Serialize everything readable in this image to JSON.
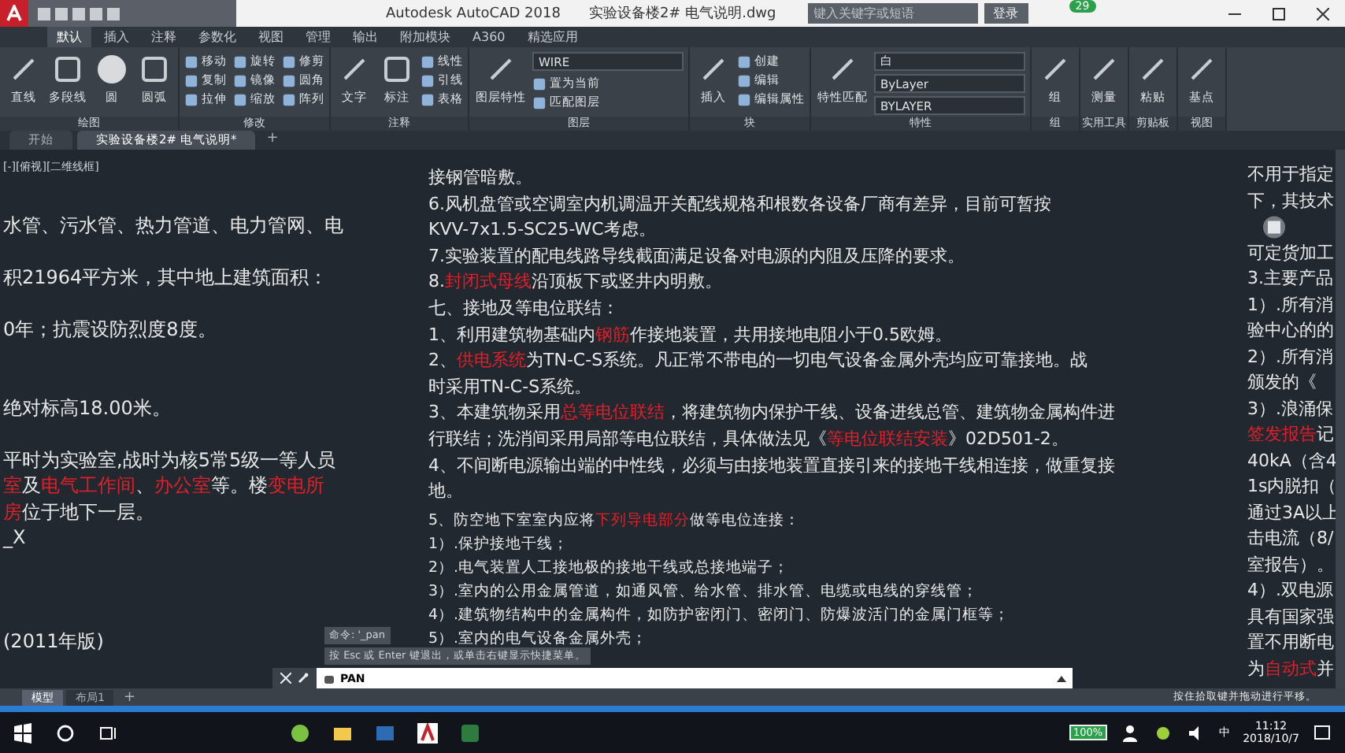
{
  "title_bar": {
    "app": "Autodesk AutoCAD 2018",
    "file": "实验设备楼2# 电气说明.dwg",
    "search": {
      "placeholder": "键入关键字或短语"
    },
    "login": "登录",
    "badge": "29"
  },
  "ribbon_tabs": [
    {
      "label": "默认",
      "selected": true
    },
    {
      "label": "插入",
      "selected": false
    },
    {
      "label": "注释",
      "selected": false
    },
    {
      "label": "参数化",
      "selected": false
    },
    {
      "label": "视图",
      "selected": false
    },
    {
      "label": "管理",
      "selected": false
    },
    {
      "label": "输出",
      "selected": false
    },
    {
      "label": "附加模块",
      "selected": false
    },
    {
      "label": "A360",
      "selected": false
    },
    {
      "label": "精选应用",
      "selected": false
    }
  ],
  "ribbon_panels": [
    {
      "title": "绘图",
      "tools": [
        {
          "kind": "large",
          "label": "直线"
        },
        {
          "kind": "large",
          "label": "多段线"
        },
        {
          "kind": "large",
          "label": "圆"
        },
        {
          "kind": "large",
          "label": "圆弧"
        }
      ]
    },
    {
      "title": "修改",
      "tools": [
        {
          "kind": "small",
          "label": "移动"
        },
        {
          "kind": "small",
          "label": "复制"
        },
        {
          "kind": "small",
          "label": "拉伸"
        },
        {
          "kind": "small",
          "label": "旋转"
        },
        {
          "kind": "small",
          "label": "镜像"
        },
        {
          "kind": "small",
          "label": "缩放"
        },
        {
          "kind": "small",
          "label": "修剪"
        },
        {
          "kind": "small",
          "label": "圆角"
        },
        {
          "kind": "small",
          "label": "阵列"
        }
      ]
    },
    {
      "title": "注释",
      "tools": [
        {
          "kind": "large",
          "label": "文字"
        },
        {
          "kind": "large",
          "label": "标注"
        },
        {
          "kind": "small",
          "label": "线性"
        },
        {
          "kind": "small",
          "label": "引线"
        },
        {
          "kind": "small",
          "label": "表格"
        }
      ]
    },
    {
      "title": "图层",
      "tools": [
        {
          "kind": "large",
          "label": "图层特性"
        },
        {
          "kind": "dropdown",
          "label": "WIRE"
        },
        {
          "kind": "small",
          "label": "置为当前"
        },
        {
          "kind": "small",
          "label": "匹配图层"
        }
      ]
    },
    {
      "title": "块",
      "tools": [
        {
          "kind": "large",
          "label": "插入"
        },
        {
          "kind": "small",
          "label": "创建"
        },
        {
          "kind": "small",
          "label": "编辑"
        },
        {
          "kind": "small",
          "label": "编辑属性"
        }
      ]
    },
    {
      "title": "特性",
      "tools": [
        {
          "kind": "large",
          "label": "特性匹配"
        },
        {
          "kind": "dropdown",
          "label": "白"
        },
        {
          "kind": "dropdown",
          "label": "ByLayer"
        },
        {
          "kind": "dropdown",
          "label": "BYLAYER"
        }
      ]
    },
    {
      "title": "组",
      "tools": [
        {
          "kind": "large",
          "label": "组"
        }
      ]
    },
    {
      "title": "实用工具",
      "tools": [
        {
          "kind": "large",
          "label": "测量"
        }
      ]
    },
    {
      "title": "剪贴板",
      "tools": [
        {
          "kind": "large",
          "label": "粘贴"
        }
      ]
    },
    {
      "title": "视图",
      "tools": [
        {
          "kind": "large",
          "label": "基点"
        }
      ]
    }
  ],
  "file_tabs": [
    {
      "label": "开始",
      "selected": false
    },
    {
      "label": "实验设备楼2# 电气说明*",
      "selected": true
    }
  ],
  "new_tab_button": "+",
  "viewport_label": "[-][俯视][二维线框]",
  "left_column": [
    {
      "kind": "text",
      "segments": [
        {
          "text": "水管、污水管、热力管道、电力管网、电",
          "highlight": false
        }
      ]
    },
    {
      "kind": "blank"
    },
    {
      "kind": "text",
      "segments": [
        {
          "text": "积21964平方米，其中地上建筑面积：",
          "highlight": false
        }
      ]
    },
    {
      "kind": "blank"
    },
    {
      "kind": "text",
      "segments": [
        {
          "text": "0年；抗震设防烈度8度。",
          "highlight": false
        }
      ]
    },
    {
      "kind": "blank"
    },
    {
      "kind": "blank"
    },
    {
      "kind": "text",
      "segments": [
        {
          "text": "绝对标高18.00米。",
          "highlight": false
        }
      ]
    },
    {
      "kind": "blank"
    },
    {
      "kind": "text",
      "segments": [
        {
          "text": "平时为实验室,战时为核5常5级一等人员",
          "highlight": false
        }
      ]
    },
    {
      "kind": "text",
      "segments": [
        {
          "text": "室",
          "highlight": true
        },
        {
          "text": "及",
          "highlight": false
        },
        {
          "text": "电气工作间",
          "highlight": true
        },
        {
          "text": "、",
          "highlight": false
        },
        {
          "text": "办公室",
          "highlight": true
        },
        {
          "text": "等。楼",
          "highlight": false
        },
        {
          "text": "变电所",
          "highlight": true
        }
      ]
    },
    {
      "kind": "text",
      "segments": [
        {
          "text": "房",
          "highlight": true
        },
        {
          "text": "位于地下一层。",
          "highlight": false
        }
      ]
    },
    {
      "kind": "text",
      "segments": [
        {
          "text": "_X",
          "highlight": false
        }
      ]
    },
    {
      "kind": "blank"
    },
    {
      "kind": "blank"
    },
    {
      "kind": "blank"
    },
    {
      "kind": "text",
      "segments": [
        {
          "text": "(2011年版)",
          "highlight": false
        }
      ]
    }
  ],
  "middle_column": {
    "lines": [
      [
        {
          "text": "接钢管暗敷。",
          "highlight": false
        }
      ],
      [
        {
          "text": "6.风机盘管或空调室内机调温开关配线规格和根数各设备厂商有差异，目前可暂按",
          "highlight": false
        }
      ],
      [
        {
          "text": "KVV-7x1.5-SC25-WC考虑。",
          "highlight": false
        }
      ],
      [
        {
          "text": "7.实验装置的配电线路导线截面满足设备对电源的内阻及压降的要求。",
          "highlight": false
        }
      ],
      [
        {
          "text": "8.",
          "highlight": false
        },
        {
          "text": "封闭式母线",
          "highlight": true
        },
        {
          "text": "沿顶板下或竖井内明敷。",
          "highlight": false
        }
      ],
      [
        {
          "text": "七、接地及等电位联结：",
          "highlight": false
        }
      ],
      [
        {
          "text": "1、利用建筑物基础内",
          "highlight": false
        },
        {
          "text": "钢筋",
          "highlight": true
        },
        {
          "text": "作接地装置，共用接地电阻小于0.5欧姆。",
          "highlight": false
        }
      ],
      [
        {
          "text": "2、",
          "highlight": false
        },
        {
          "text": "供电系统",
          "highlight": true
        },
        {
          "text": "为TN-C-S系统。凡正常不带电的一切电气设备金属外壳均应可靠接地。战",
          "highlight": false
        }
      ],
      [
        {
          "text": "时采用TN-C-S系统。",
          "highlight": false
        }
      ],
      [
        {
          "text": "3、本建筑物采用",
          "highlight": false
        },
        {
          "text": "总等电位联结",
          "highlight": true
        },
        {
          "text": "，将建筑物内保护干线、设备进线总管、建筑物金属构件进",
          "highlight": false
        }
      ],
      [
        {
          "text": "行联结；洗消间采用局部等电位联结，具体做法见《",
          "highlight": false
        },
        {
          "text": "等电位联结安装",
          "highlight": true
        },
        {
          "text": "》02D501-2。",
          "highlight": false
        }
      ],
      [
        {
          "text": "4、不间断电源输出端的中性线，必须与由接地装置直接引来的接地干线相连接，做重复接",
          "highlight": false
        }
      ],
      [
        {
          "text": "地。",
          "highlight": false
        }
      ]
    ],
    "sub_lines": [
      [
        {
          "text": "5、防空地下室室内应将",
          "highlight": false
        },
        {
          "text": "下列导电部分",
          "highlight": true
        },
        {
          "text": "做等电位连接：",
          "highlight": false
        }
      ],
      [
        {
          "text": "1）.保护接地干线；",
          "highlight": false
        }
      ],
      [
        {
          "text": "2）.电气装置人工接地极的接地干线或总接地端子；",
          "highlight": false
        }
      ],
      [
        {
          "text": "3）.室内的公用金属管道，如通风管、给水管、排水管、电缆或电线的穿线管；",
          "highlight": false
        }
      ],
      [
        {
          "text": "4）.建筑物结构中的金属构件，如防护密闭门、密闭门、防爆波活门的金属门框等；",
          "highlight": false
        }
      ],
      [
        {
          "text": "5）.室内的电气设备金属外壳；",
          "highlight": false
        }
      ]
    ]
  },
  "right_column": [
    {
      "kind": "text",
      "segments": [
        {
          "text": "不用于指定",
          "highlight": false
        }
      ]
    },
    {
      "kind": "text",
      "segments": [
        {
          "text": "下，其技术",
          "highlight": false
        }
      ]
    },
    {
      "kind": "wheel"
    },
    {
      "kind": "text",
      "segments": [
        {
          "text": "可定货加工",
          "highlight": false
        }
      ]
    },
    {
      "kind": "text",
      "segments": [
        {
          "text": "3.主要产品",
          "highlight": false
        }
      ]
    },
    {
      "kind": "text",
      "segments": [
        {
          "text": "1）.所有消",
          "highlight": false
        }
      ]
    },
    {
      "kind": "text",
      "segments": [
        {
          "text": "验中心的的",
          "highlight": false
        }
      ]
    },
    {
      "kind": "text",
      "segments": [
        {
          "text": "2）.所有消",
          "highlight": false
        }
      ]
    },
    {
      "kind": "text",
      "segments": [
        {
          "text": "颁发的《",
          "highlight": false
        }
      ]
    },
    {
      "kind": "text",
      "segments": [
        {
          "text": "3）.浪涌保",
          "highlight": false
        }
      ]
    },
    {
      "kind": "text",
      "segments": [
        {
          "text": "签发报告",
          "highlight": true
        },
        {
          "text": "记",
          "highlight": false
        }
      ]
    },
    {
      "kind": "text",
      "segments": [
        {
          "text": "40kA（含4",
          "highlight": false
        }
      ]
    },
    {
      "kind": "text",
      "segments": [
        {
          "text": "1s内脱扣（",
          "highlight": false
        }
      ]
    },
    {
      "kind": "text",
      "segments": [
        {
          "text": "通过3A以上",
          "highlight": false
        }
      ]
    },
    {
      "kind": "text",
      "segments": [
        {
          "text": "击电流（8/",
          "highlight": false
        }
      ]
    },
    {
      "kind": "text",
      "segments": [
        {
          "text": "室报告）。",
          "highlight": false
        }
      ]
    },
    {
      "kind": "text",
      "segments": [
        {
          "text": "4）.双电源",
          "highlight": false
        }
      ]
    },
    {
      "kind": "text",
      "segments": [
        {
          "text": "具有国家强",
          "highlight": false
        }
      ]
    },
    {
      "kind": "text",
      "segments": [
        {
          "text": "置不用断电",
          "highlight": false
        }
      ]
    },
    {
      "kind": "text",
      "segments": [
        {
          "text": "为",
          "highlight": false
        },
        {
          "text": "自动式",
          "highlight": true
        },
        {
          "text": "并",
          "highlight": false
        }
      ]
    }
  ],
  "command": {
    "history": [
      "命令: '_pan",
      "按 Esc 或 Enter 键退出，或单击右键显示快捷菜单。"
    ],
    "value": "PAN"
  },
  "layout_tabs": [
    {
      "label": "模型",
      "selected": true
    },
    {
      "label": "布局1",
      "selected": false
    }
  ],
  "new_layout_button": "+",
  "status_text": "按住拾取键并拖动进行平移。",
  "taskbar": {
    "battery": "100%",
    "ime": "中",
    "time": "11:12",
    "date": "2018/10/7"
  }
}
